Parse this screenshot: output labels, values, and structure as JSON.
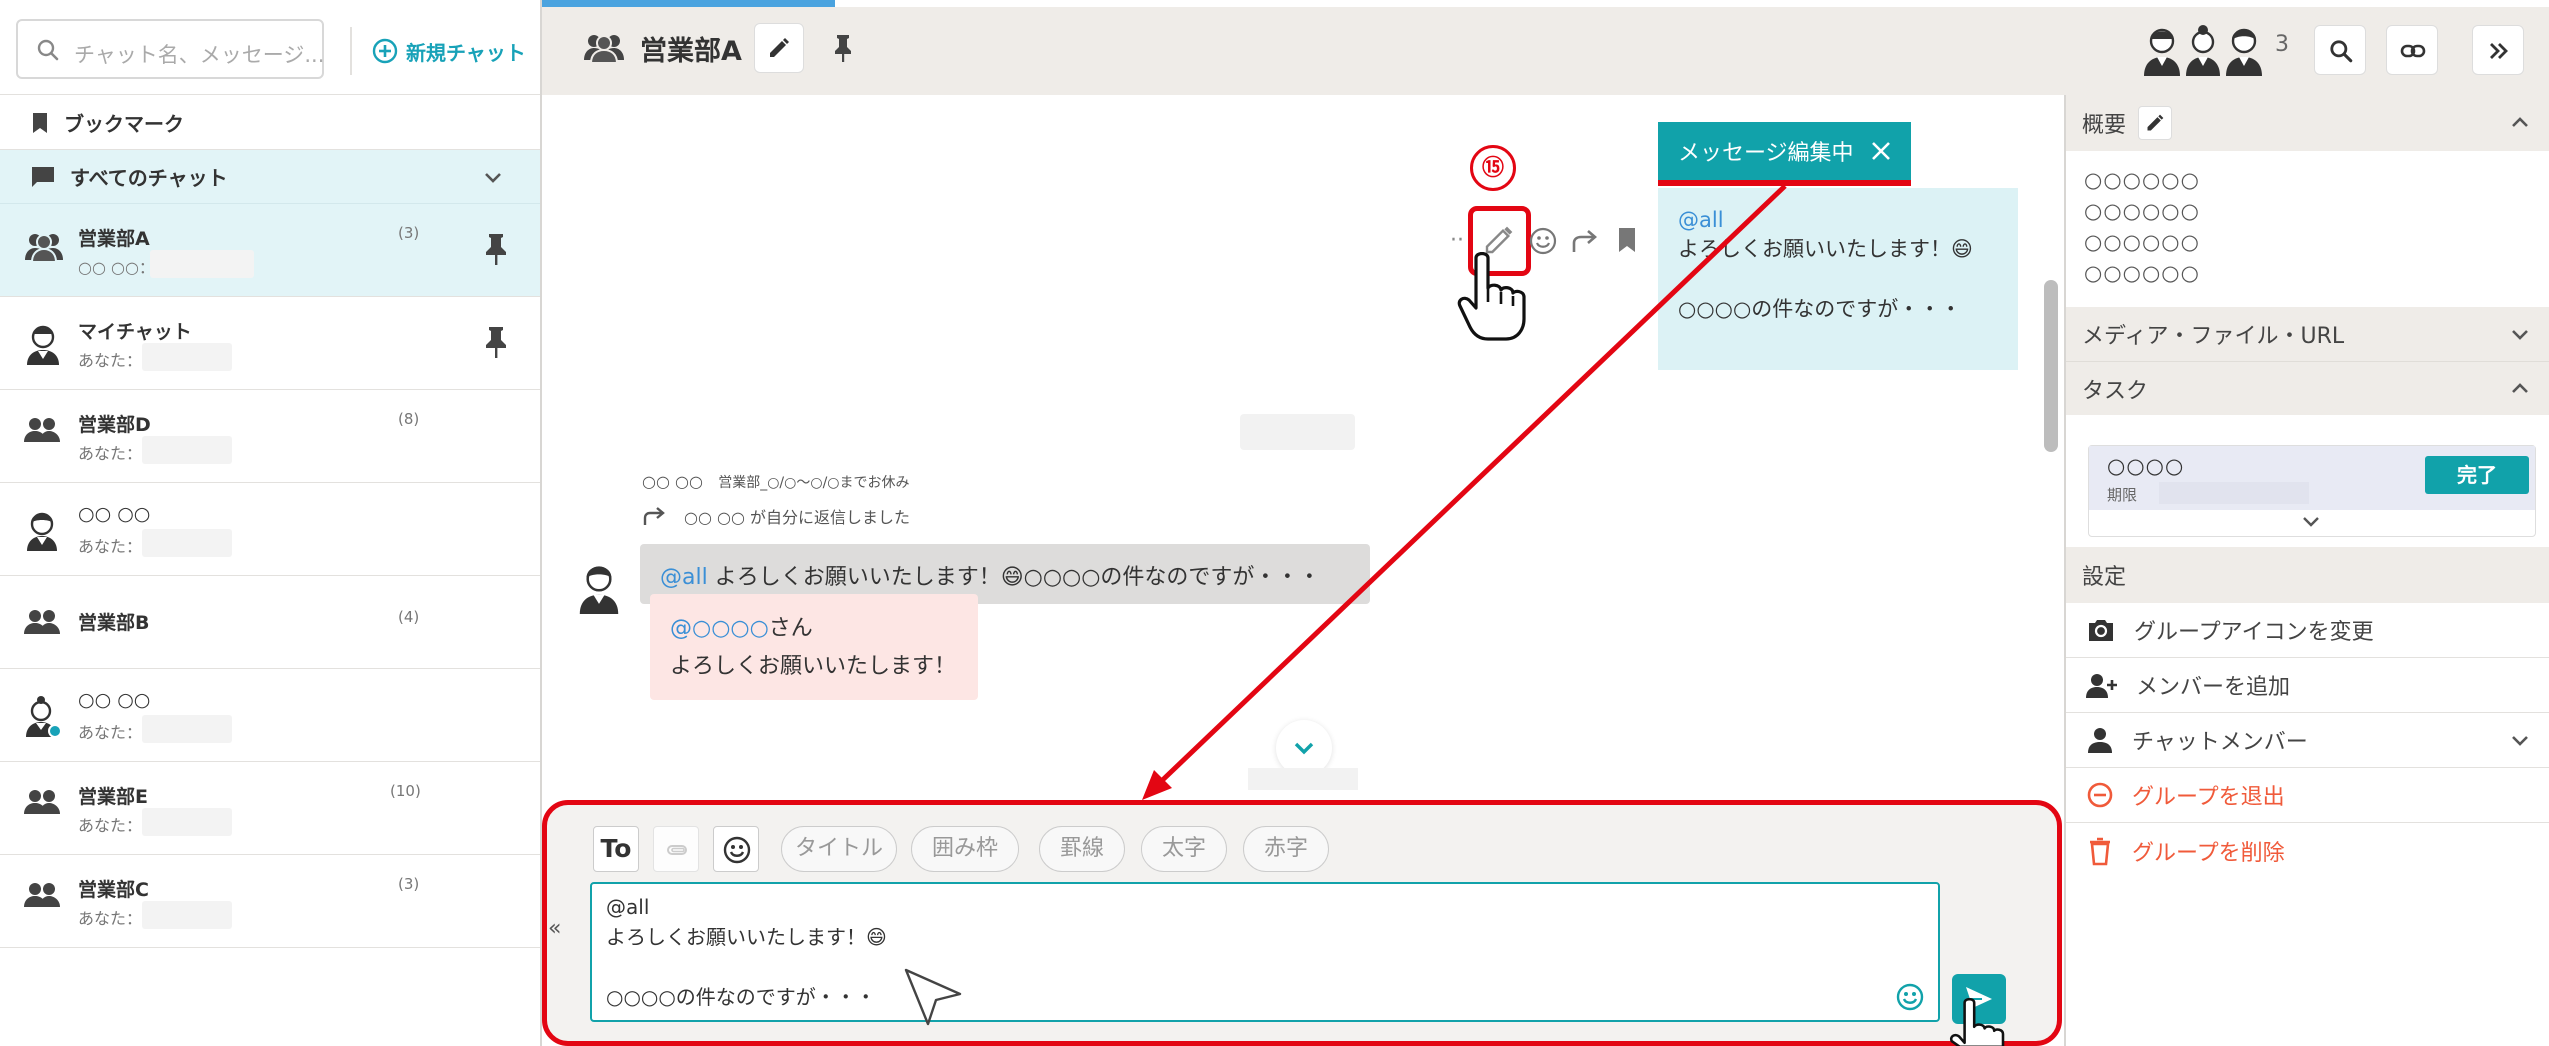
{
  "sidebar": {
    "search_placeholder": "チャット名、メッセージ...",
    "new_chat_label": "新規チャット",
    "bookmark_label": "ブックマーク",
    "all_chats_label": "すべてのチャット",
    "chats": [
      {
        "name": "営業部A",
        "preview": "○○ ○○：",
        "count": "(3)"
      },
      {
        "name": "マイチャット",
        "preview": "あなた：",
        "count": ""
      },
      {
        "name": "営業部D",
        "preview": "あなた：",
        "count": "(8)"
      },
      {
        "name": "○○ ○○",
        "preview": "あなた：",
        "count": ""
      },
      {
        "name": "営業部B",
        "preview": "",
        "count": "(4)"
      },
      {
        "name": "○○ ○○",
        "preview": "あなた：",
        "count": ""
      },
      {
        "name": "営業部E",
        "preview": "あなた：",
        "count": "(10)"
      },
      {
        "name": "営業部C",
        "preview": "あなた：",
        "count": "(3)"
      }
    ]
  },
  "header": {
    "title": "営業部A",
    "member_count": "3"
  },
  "chat": {
    "step_marker": "⑮",
    "editing_label": "メッセージ編集中",
    "my_message": {
      "mention": "@all",
      "line1": "よろしくお願いいたします！😄",
      "line2": "○○○○の件なのですが・・・"
    },
    "system_line1": "○○ ○○",
    "system_line1_note": "営業部_○/○～○/○までお休み",
    "system_line2": "○○ ○○ が自分に返信しました",
    "quoted_mention": "@all",
    "quoted_text": " よろしくお願いいたします！😄○○○○の件なのですが・・・",
    "reply_mention": "@○○○○",
    "reply_suffix": "さん",
    "reply_text": "よろしくお願いいたします！"
  },
  "composer": {
    "to_label": "To",
    "format_buttons": [
      "タイトル",
      "囲み枠",
      "罫線",
      "太字",
      "赤字"
    ],
    "collapse_label": "«",
    "text_lines": [
      "@all",
      "よろしくお願いいたします！😄",
      "",
      "○○○○の件なのですが・・・"
    ]
  },
  "right_panel": {
    "overview_label": "概要",
    "overview_lines": [
      "○○○○○○",
      "○○○○○○",
      "○○○○○○",
      "○○○○○○"
    ],
    "media_label": "メディア・ファイル・URL",
    "task_label": "タスク",
    "task_name": "○○○○",
    "task_due_label": "期限",
    "task_done_label": "完了",
    "settings_label": "設定",
    "change_icon_label": "グループアイコンを変更",
    "add_member_label": "メンバーを追加",
    "chat_members_label": "チャットメンバー",
    "leave_group_label": "グループを退出",
    "delete_group_label": "グループを削除"
  },
  "colors": {
    "accent_teal": "#11a2aa",
    "annotation_red": "#e30613",
    "active_row": "#e2f4f7",
    "danger_text": "#f05a3a"
  },
  "icons": [
    "search-icon",
    "plus-circle-icon",
    "bookmark-icon",
    "chat-bubble-icon",
    "chevron-down-icon",
    "group-icon",
    "person-icon",
    "pin-icon",
    "pencil-icon",
    "link-icon",
    "double-chevron-right-icon",
    "emoji-icon",
    "reply-arrow-icon",
    "paperclip-icon",
    "send-icon",
    "camera-icon",
    "add-person-icon",
    "minus-circle-icon",
    "trash-icon",
    "close-icon",
    "pointing-hand-icon",
    "mouse-cursor-icon"
  ]
}
